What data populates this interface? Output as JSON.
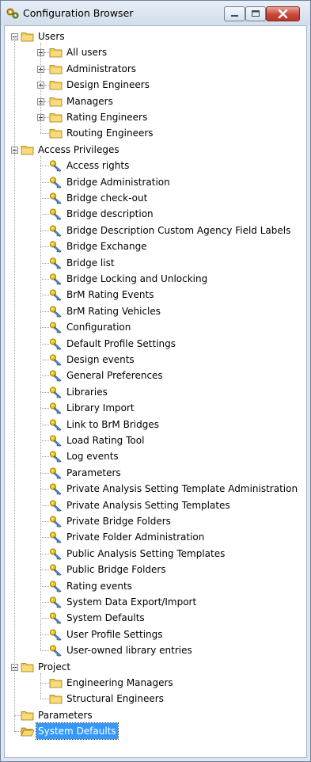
{
  "window": {
    "title": "Configuration Browser"
  },
  "tree": [
    {
      "label": "Users",
      "icon": "folder-icon",
      "level": 0,
      "expander": "minus",
      "children": [
        {
          "label": "All users",
          "icon": "folder-icon",
          "level": 1,
          "expander": "plus"
        },
        {
          "label": "Administrators",
          "icon": "folder-icon",
          "level": 1,
          "expander": "plus"
        },
        {
          "label": "Design Engineers",
          "icon": "folder-icon",
          "level": 1,
          "expander": "plus"
        },
        {
          "label": "Managers",
          "icon": "folder-icon",
          "level": 1,
          "expander": "plus"
        },
        {
          "label": "Rating Engineers",
          "icon": "folder-icon",
          "level": 1,
          "expander": "plus"
        },
        {
          "label": "Routing Engineers",
          "icon": "folder-icon",
          "level": 1,
          "expander": "none"
        }
      ]
    },
    {
      "label": "Access Privileges",
      "icon": "folder-icon",
      "level": 0,
      "expander": "minus",
      "children": [
        {
          "label": "Access rights",
          "icon": "key-icon",
          "level": 1
        },
        {
          "label": "Bridge Administration",
          "icon": "key-icon",
          "level": 1
        },
        {
          "label": "Bridge check-out",
          "icon": "key-icon",
          "level": 1
        },
        {
          "label": "Bridge description",
          "icon": "key-icon",
          "level": 1
        },
        {
          "label": "Bridge Description Custom Agency Field Labels",
          "icon": "key-icon",
          "level": 1
        },
        {
          "label": "Bridge Exchange",
          "icon": "key-icon",
          "level": 1
        },
        {
          "label": "Bridge list",
          "icon": "key-icon",
          "level": 1
        },
        {
          "label": "Bridge Locking and Unlocking",
          "icon": "key-icon",
          "level": 1
        },
        {
          "label": "BrM Rating Events",
          "icon": "key-icon",
          "level": 1
        },
        {
          "label": "BrM Rating Vehicles",
          "icon": "key-icon",
          "level": 1
        },
        {
          "label": "Configuration",
          "icon": "key-icon",
          "level": 1
        },
        {
          "label": "Default Profile Settings",
          "icon": "key-icon",
          "level": 1
        },
        {
          "label": "Design events",
          "icon": "key-icon",
          "level": 1
        },
        {
          "label": "General Preferences",
          "icon": "key-icon",
          "level": 1
        },
        {
          "label": "Libraries",
          "icon": "key-icon",
          "level": 1
        },
        {
          "label": "Library Import",
          "icon": "key-icon",
          "level": 1
        },
        {
          "label": "Link to BrM Bridges",
          "icon": "key-icon",
          "level": 1
        },
        {
          "label": "Load Rating Tool",
          "icon": "key-icon",
          "level": 1
        },
        {
          "label": "Log events",
          "icon": "key-icon",
          "level": 1
        },
        {
          "label": "Parameters",
          "icon": "key-icon",
          "level": 1
        },
        {
          "label": "Private Analysis Setting Template Administration",
          "icon": "key-icon",
          "level": 1
        },
        {
          "label": "Private Analysis Setting Templates",
          "icon": "key-icon",
          "level": 1
        },
        {
          "label": "Private Bridge Folders",
          "icon": "key-icon",
          "level": 1
        },
        {
          "label": "Private Folder Administration",
          "icon": "key-icon",
          "level": 1
        },
        {
          "label": "Public Analysis Setting Templates",
          "icon": "key-icon",
          "level": 1
        },
        {
          "label": "Public Bridge Folders",
          "icon": "key-icon",
          "level": 1
        },
        {
          "label": "Rating events",
          "icon": "key-icon",
          "level": 1
        },
        {
          "label": "System Data Export/Import",
          "icon": "key-icon",
          "level": 1
        },
        {
          "label": "System Defaults",
          "icon": "key-icon",
          "level": 1
        },
        {
          "label": "User Profile Settings",
          "icon": "key-icon",
          "level": 1
        },
        {
          "label": "User-owned library entries",
          "icon": "key-icon",
          "level": 1
        }
      ]
    },
    {
      "label": "Project",
      "icon": "folder-icon",
      "level": 0,
      "expander": "minus",
      "children": [
        {
          "label": "Engineering Managers",
          "icon": "folder-icon",
          "level": 1,
          "expander": "none"
        },
        {
          "label": "Structural Engineers",
          "icon": "folder-icon",
          "level": 1,
          "expander": "none"
        }
      ]
    },
    {
      "label": "Parameters",
      "icon": "folder-icon",
      "level": 0,
      "expander": "none"
    },
    {
      "label": "System Defaults",
      "icon": "folder-open-icon",
      "level": 0,
      "expander": "none",
      "selected": true
    }
  ],
  "colors": {
    "selection": "#3399ff",
    "folder": "#f0c94a",
    "key": "#e8b800"
  }
}
